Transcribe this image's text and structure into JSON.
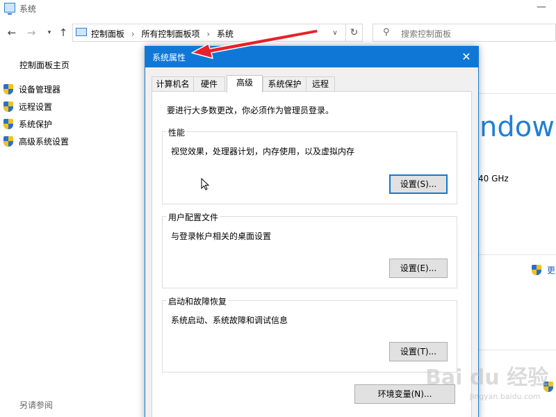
{
  "window": {
    "title": "系统",
    "minimize_glyph": "—"
  },
  "address_bar": {
    "crumbs": [
      "控制面板",
      "所有控制面板项",
      "系统"
    ],
    "separator": "›"
  },
  "search": {
    "placeholder": "搜索控制面板"
  },
  "sidebar": {
    "home": "控制面板主页",
    "items": [
      {
        "label": "设备管理器"
      },
      {
        "label": "远程设置"
      },
      {
        "label": "系统保护"
      },
      {
        "label": "高级系统设置"
      }
    ],
    "see_also": "另请参阅"
  },
  "main_bg": {
    "windows_text": "ndow",
    "cpu_speed_text": "40 GHz",
    "change_link": "更改",
    "change_link_2": "更"
  },
  "dialog": {
    "title": "系统属性",
    "close_glyph": "✕",
    "tabs": [
      {
        "label": "计算机名"
      },
      {
        "label": "硬件"
      },
      {
        "label": "高级"
      },
      {
        "label": "系统保护"
      },
      {
        "label": "远程"
      }
    ],
    "active_tab": "高级",
    "admin_note": "要进行大多数更改，你必须作为管理员登录。",
    "groups": {
      "performance": {
        "legend": "性能",
        "description": "视觉效果，处理器计划，内存使用，以及虚拟内存",
        "button": "设置(S)..."
      },
      "user_profiles": {
        "legend": "用户配置文件",
        "description": "与登录帐户相关的桌面设置",
        "button": "设置(E)..."
      },
      "startup_recovery": {
        "legend": "启动和故障恢复",
        "description": "系统启动、系统故障和调试信息",
        "button": "设置(T)..."
      }
    },
    "env_button": "环境变量(N)..."
  },
  "watermark": {
    "main": "Bai du 经验",
    "sub": "jingyan.baidu.com"
  },
  "colors": {
    "accent": "#0f78d7",
    "annotation_arrow": "#e8212a"
  }
}
